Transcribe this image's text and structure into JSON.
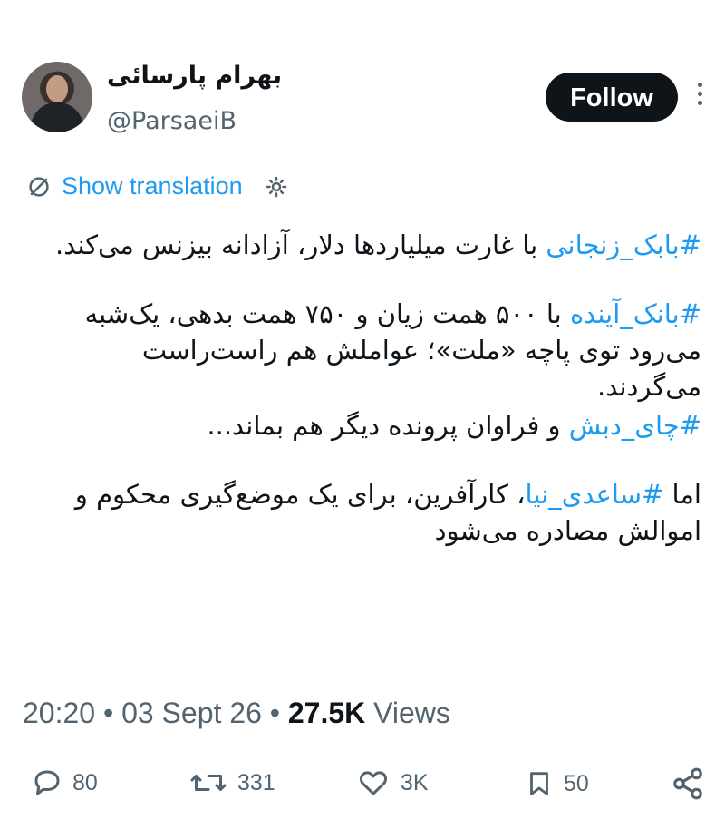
{
  "author": {
    "name": "بهرام پارسائی",
    "handle": "@ParsaeiB"
  },
  "follow_label": "Follow",
  "translation_label": "Show translation",
  "tweet": {
    "p1_hashtag": "#بابک_زنجانی",
    "p1_text": " با غارت میلیاردها دلار، آزادانه بیزنس می‌کند.",
    "p2_hashtag": "#بانک_آینده",
    "p2_text": " با ۵۰۰ همت زیان و ۷۵۰ همت بدهی، یک‌شبه می‌رود توی پاچه «ملت»؛ عواملش هم راست‌راست می‌گردند.",
    "p3_hashtag": "#چای_دبش",
    "p3_text": " و فراوان پرونده دیگر هم بماند...",
    "p4_prefix": "اما ",
    "p4_hashtag": "#ساعدی_نیا",
    "p4_text": "، کارآفرین، برای یک موضع‌گیری محکوم و اموالش مصادره می‌شود"
  },
  "meta": {
    "time": "20:20",
    "date": "03 Sept 26",
    "views_count": "27.5K",
    "views_label": "Views"
  },
  "actions": {
    "replies": "80",
    "reposts": "331",
    "likes": "3K",
    "bookmarks": "50"
  },
  "icons": [
    "translate-icon",
    "gear-icon",
    "reply-icon",
    "repost-icon",
    "like-icon",
    "bookmark-icon",
    "share-icon"
  ]
}
